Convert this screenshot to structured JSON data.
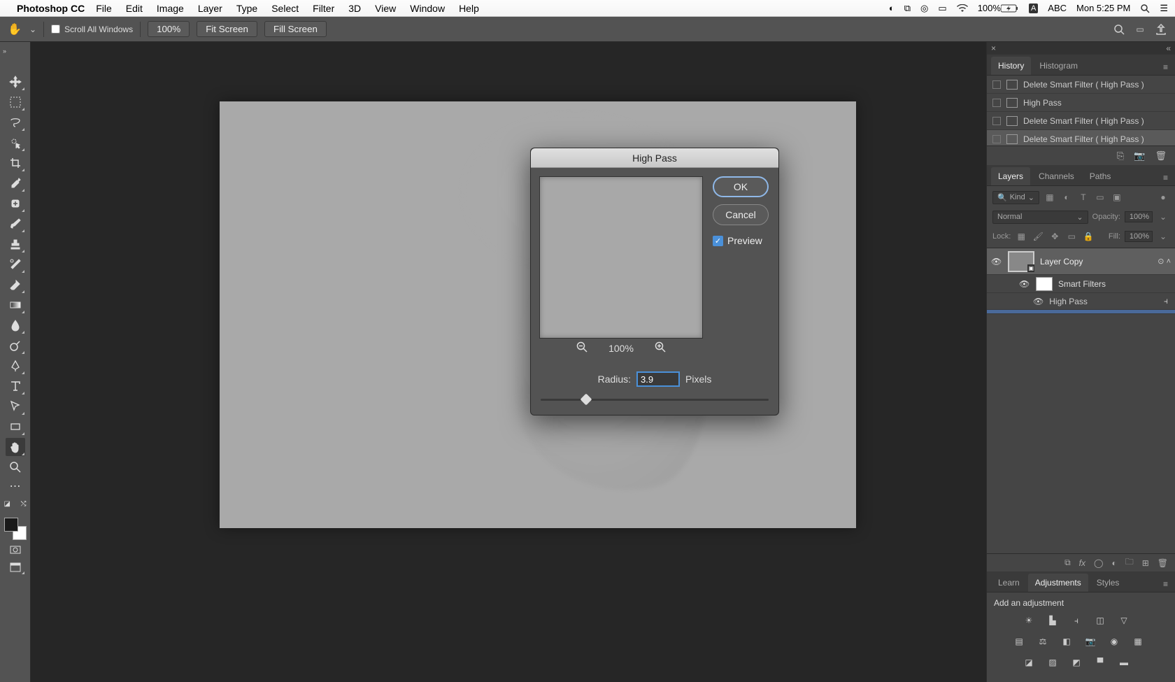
{
  "menubar": {
    "app": "Photoshop CC",
    "items": [
      "File",
      "Edit",
      "Image",
      "Layer",
      "Type",
      "Select",
      "Filter",
      "3D",
      "View",
      "Window",
      "Help"
    ],
    "status": {
      "battery": "100%",
      "ime": "ABC",
      "clock": "Mon 5:25 PM"
    }
  },
  "optionsbar": {
    "scroll_all_label": "Scroll All Windows",
    "zoom": "100%",
    "fit": "Fit Screen",
    "fill": "Fill Screen"
  },
  "history": {
    "tab1": "History",
    "tab2": "Histogram",
    "items": [
      "Delete Smart Filter ( High Pass )",
      "High Pass",
      "Delete Smart Filter ( High Pass )",
      "Delete Smart Filter ( High Pass )"
    ]
  },
  "layers": {
    "tab1": "Layers",
    "tab2": "Channels",
    "tab3": "Paths",
    "kind": "Kind",
    "blend": "Normal",
    "opacity_label": "Opacity:",
    "opacity": "100%",
    "lock_label": "Lock:",
    "fill_label": "Fill:",
    "fill": "100%",
    "layer_name": "Layer Copy",
    "smart_filters": "Smart Filters",
    "filter_name": "High Pass"
  },
  "adjust": {
    "tab1": "Learn",
    "tab2": "Adjustments",
    "tab3": "Styles",
    "title": "Add an adjustment"
  },
  "dialog": {
    "title": "High Pass",
    "ok": "OK",
    "cancel": "Cancel",
    "preview": "Preview",
    "zoom": "100%",
    "radius_label": "Radius:",
    "radius_value": "3.9",
    "radius_unit": "Pixels"
  }
}
